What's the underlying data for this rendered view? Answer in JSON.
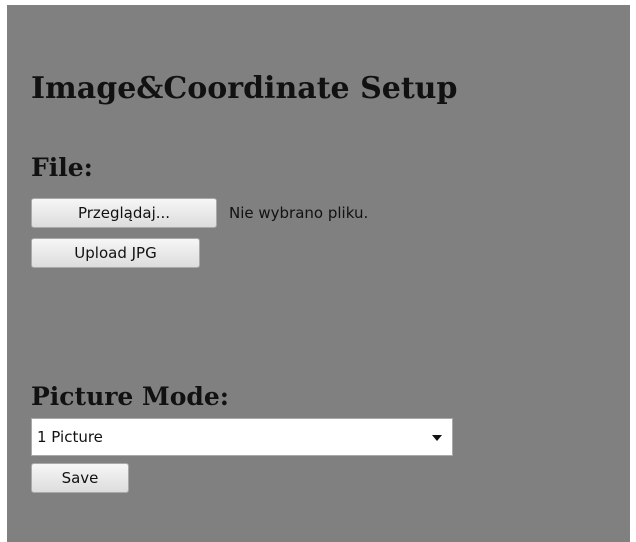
{
  "page": {
    "title": "Image&Coordinate Setup"
  },
  "file_section": {
    "heading": "File:",
    "browse_label": "Przeglądaj...",
    "file_status": "Nie wybrano pliku.",
    "upload_label": "Upload JPG"
  },
  "mode_section": {
    "heading": "Picture Mode:",
    "selected": "1 Picture",
    "save_label": "Save"
  },
  "icons": {
    "dropdown": "chevron-down-icon"
  },
  "colors": {
    "panel_background": "#808080",
    "page_background": "#ffffff"
  }
}
